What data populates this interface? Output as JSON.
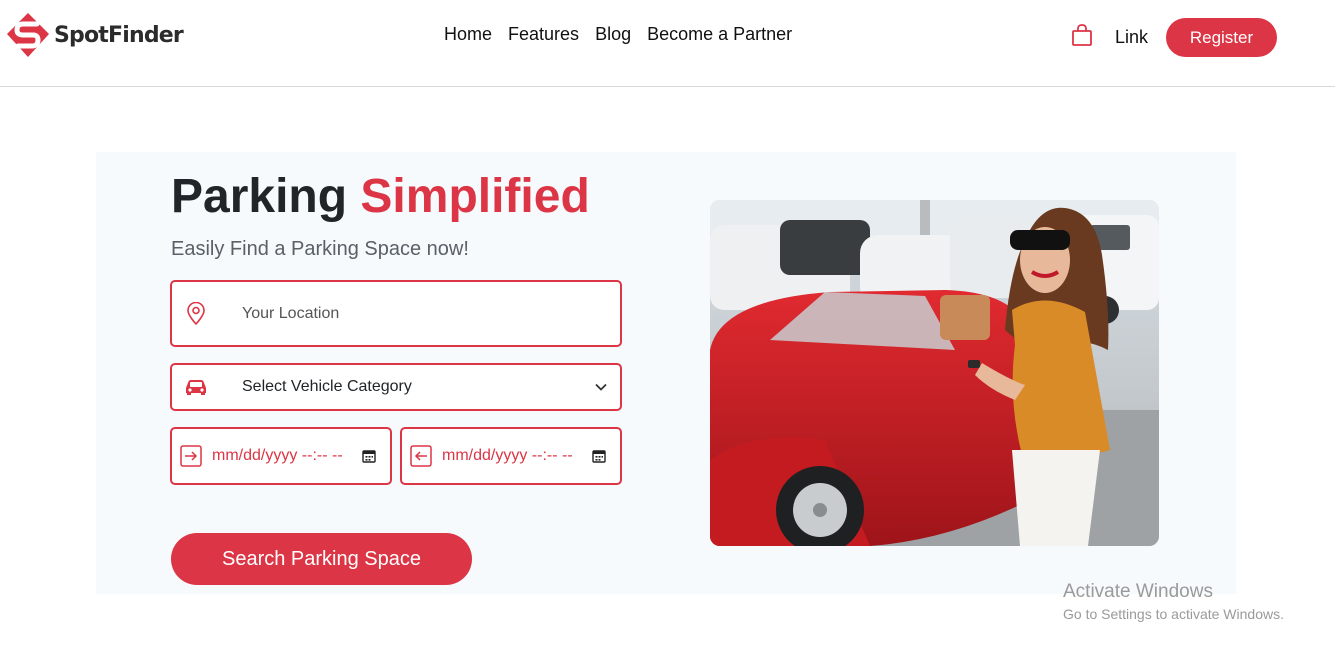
{
  "brand": {
    "name": "SpotFinder",
    "color": "#dc3545"
  },
  "nav": {
    "links": [
      "Home",
      "Features",
      "Blog",
      "Become a Partner"
    ],
    "cart_icon": "shopping-bag-icon",
    "right_link": "Link",
    "register_label": "Register"
  },
  "hero": {
    "title_main": "Parking",
    "title_accent": "Simplified",
    "subtitle": "Easily Find a Parking Space now!",
    "location": {
      "placeholder": "Your Location",
      "icon": "map-pin-icon"
    },
    "vehicle": {
      "selected": "Select Vehicle Category",
      "icon": "car-icon"
    },
    "check_in": {
      "value": "mm/dd/yyyy --:-- --",
      "icon": "arrow-in-icon"
    },
    "check_out": {
      "value": "mm/dd/yyyy --:-- --",
      "icon": "arrow-out-icon"
    },
    "search_label": "Search Parking Space",
    "photo": "woman-with-red-convertible-photo"
  },
  "watermark": {
    "line1": "Activate Windows",
    "line2": "Go to Settings to activate Windows."
  }
}
